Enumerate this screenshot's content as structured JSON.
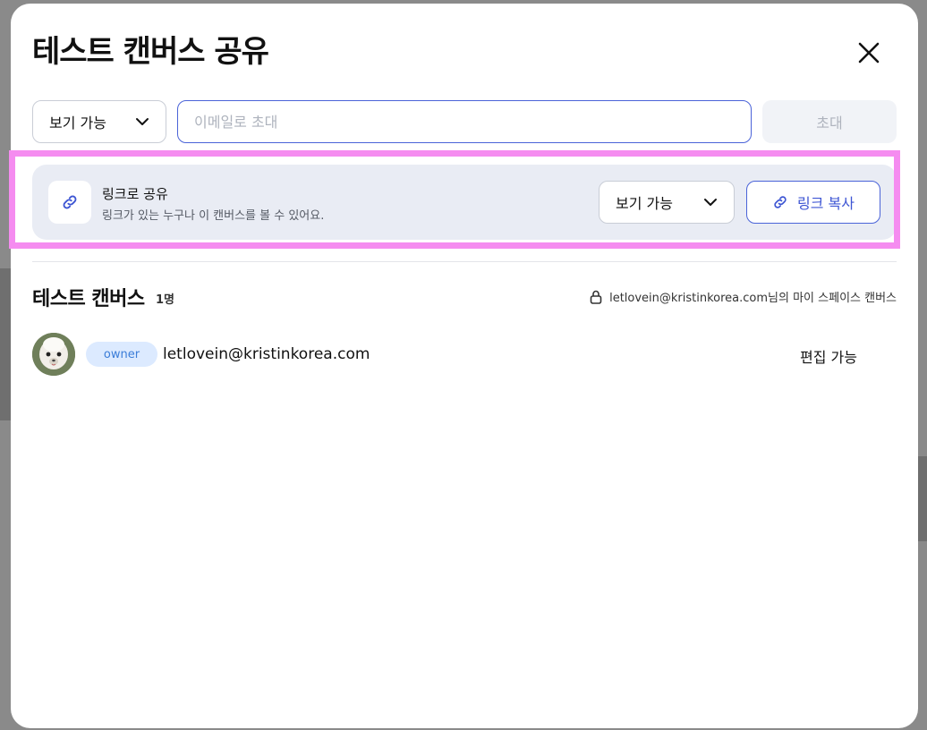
{
  "dialog": {
    "title": "테스트 캔버스 공유",
    "close_icon": "close-icon"
  },
  "invite": {
    "permission_label": "보기 가능",
    "email_placeholder": "이메일로 초대",
    "email_value": "",
    "button_label": "초대"
  },
  "link_share": {
    "title": "링크로 공유",
    "description": "링크가 있는 누구나 이 캔버스를 볼 수 있어요.",
    "permission_label": "보기 가능",
    "copy_button_label": "링크 복사",
    "highlight_color": "#f58cf0"
  },
  "members": {
    "canvas_name": "테스트 캔버스",
    "count_label": "1명",
    "owner_space_label": "letlovein@kristinkorea.com님의 마이 스페이스 캔버스",
    "list": [
      {
        "role": "owner",
        "email": "letlovein@kristinkorea.com",
        "permission": "편집 가능"
      }
    ]
  },
  "colors": {
    "accent": "#3d55d3",
    "badge_bg": "#dceaff",
    "badge_text": "#3b7dd8",
    "panel_bg": "#e9ecf4"
  }
}
